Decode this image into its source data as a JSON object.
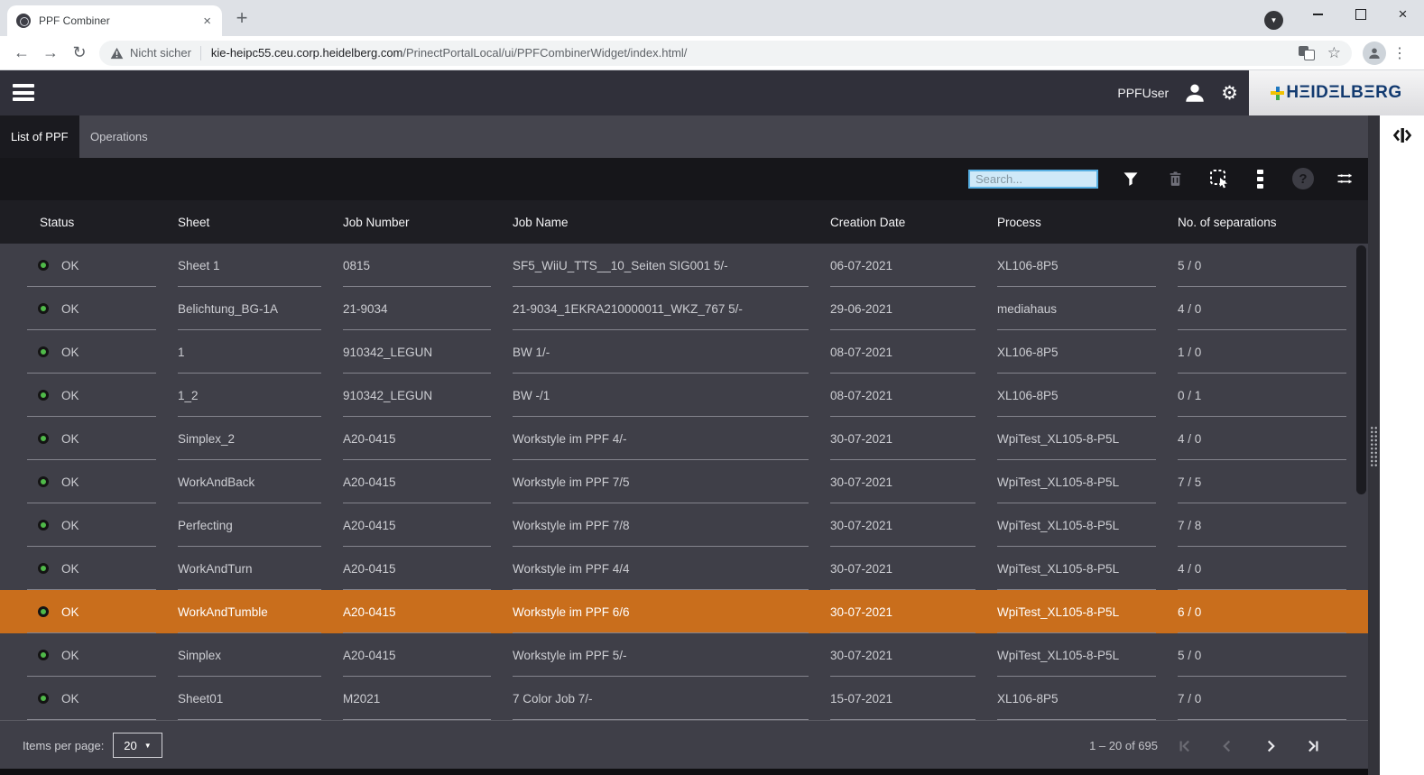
{
  "browser": {
    "tab_title": "PPF Combiner",
    "security_label": "Nicht sicher",
    "url_domain": "kie-heipc55.ceu.corp.heidelberg.com",
    "url_path": "/PrinectPortalLocal/ui/PPFCombinerWidget/index.html/"
  },
  "header": {
    "user_label": "PPFUser",
    "brand": "HEIDELBERG",
    "brand_display": "HΞIDΞLBΞRG"
  },
  "tabs": [
    {
      "label": "List of PPF",
      "active": true
    },
    {
      "label": "Operations",
      "active": false
    }
  ],
  "toolbar": {
    "search_placeholder": "Search..."
  },
  "table": {
    "columns": [
      "Status",
      "Sheet",
      "Job Number",
      "Job Name",
      "Creation Date",
      "Process",
      "No. of separations"
    ],
    "rows": [
      {
        "status": "OK",
        "sheet": "Sheet 1",
        "job_number": "0815",
        "job_name": "SF5_WiiU_TTS__10_Seiten SIG001 5/-",
        "creation_date": "06-07-2021",
        "process": "XL106-8P5",
        "separations": "5 / 0",
        "selected": false
      },
      {
        "status": "OK",
        "sheet": "Belichtung_BG-1A",
        "job_number": "21-9034",
        "job_name": "21-9034_1EKRA210000011_WKZ_767 5/-",
        "creation_date": "29-06-2021",
        "process": "mediahaus",
        "separations": "4 / 0",
        "selected": false
      },
      {
        "status": "OK",
        "sheet": "1",
        "job_number": "910342_LEGUN",
        "job_name": "BW 1/-",
        "creation_date": "08-07-2021",
        "process": "XL106-8P5",
        "separations": "1 / 0",
        "selected": false
      },
      {
        "status": "OK",
        "sheet": "1_2",
        "job_number": "910342_LEGUN",
        "job_name": "BW -/1",
        "creation_date": "08-07-2021",
        "process": "XL106-8P5",
        "separations": "0 / 1",
        "selected": false
      },
      {
        "status": "OK",
        "sheet": "Simplex_2",
        "job_number": "A20-0415",
        "job_name": "Workstyle im PPF 4/-",
        "creation_date": "30-07-2021",
        "process": "WpiTest_XL105-8-P5L",
        "separations": "4 / 0",
        "selected": false
      },
      {
        "status": "OK",
        "sheet": "WorkAndBack",
        "job_number": "A20-0415",
        "job_name": "Workstyle im PPF 7/5",
        "creation_date": "30-07-2021",
        "process": "WpiTest_XL105-8-P5L",
        "separations": "7 / 5",
        "selected": false
      },
      {
        "status": "OK",
        "sheet": "Perfecting",
        "job_number": "A20-0415",
        "job_name": "Workstyle im PPF 7/8",
        "creation_date": "30-07-2021",
        "process": "WpiTest_XL105-8-P5L",
        "separations": "7 / 8",
        "selected": false
      },
      {
        "status": "OK",
        "sheet": "WorkAndTurn",
        "job_number": "A20-0415",
        "job_name": "Workstyle im PPF 4/4",
        "creation_date": "30-07-2021",
        "process": "WpiTest_XL105-8-P5L",
        "separations": "4 / 0",
        "selected": false
      },
      {
        "status": "OK",
        "sheet": "WorkAndTumble",
        "job_number": "A20-0415",
        "job_name": "Workstyle im PPF 6/6",
        "creation_date": "30-07-2021",
        "process": "WpiTest_XL105-8-P5L",
        "separations": "6 / 0",
        "selected": true
      },
      {
        "status": "OK",
        "sheet": "Simplex",
        "job_number": "A20-0415",
        "job_name": "Workstyle im PPF 5/-",
        "creation_date": "30-07-2021",
        "process": "WpiTest_XL105-8-P5L",
        "separations": "5 / 0",
        "selected": false
      },
      {
        "status": "OK",
        "sheet": "Sheet01",
        "job_number": "M2021",
        "job_name": "7 Color Job 7/-",
        "creation_date": "15-07-2021",
        "process": "XL106-8P5",
        "separations": "7 / 0",
        "selected": false
      }
    ]
  },
  "footer": {
    "items_per_page_label": "Items per page:",
    "items_per_page_value": "20",
    "range_label": "1 – 20 of 695"
  },
  "colors": {
    "selected_row": "#c96e1c",
    "status_ok": "#4fba49",
    "search_border": "#58b0e3",
    "brand_blue": "#123a70"
  },
  "icons": {
    "back": "←",
    "forward": "→",
    "reload": "↻",
    "star": "☆",
    "kebab_menu": "⋮",
    "tab_close": "×",
    "new_tab": "+",
    "window_close": "×",
    "update_caret": "▼",
    "gear": "⚙",
    "help": "?",
    "caret_down": "▼"
  }
}
